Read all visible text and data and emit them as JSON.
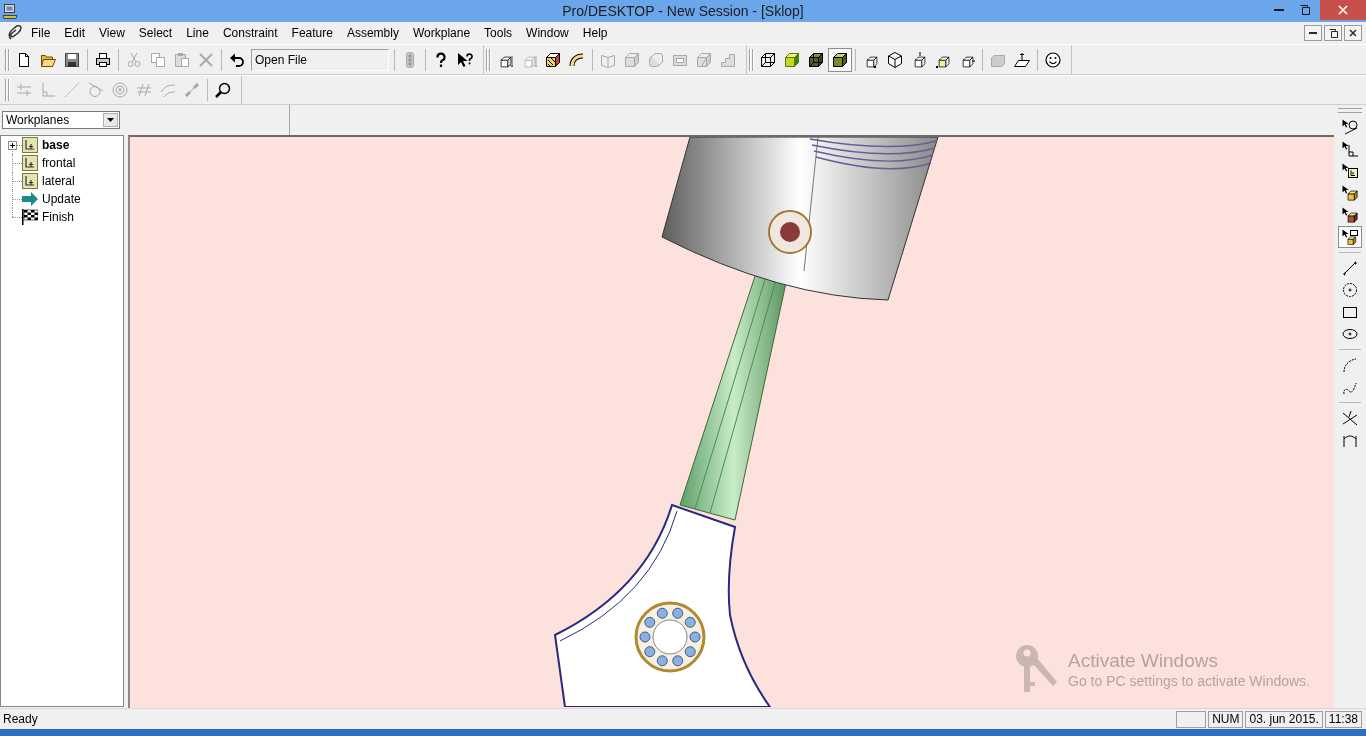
{
  "window": {
    "title": "Pro/DESKTOP - New Session - [Sklop]"
  },
  "menu_bar": {
    "items": [
      "File",
      "Edit",
      "View",
      "Select",
      "Line",
      "Constraint",
      "Feature",
      "Assembly",
      "Workplane",
      "Tools",
      "Window",
      "Help"
    ]
  },
  "toolbar_rows": [
    {
      "toolbars": [
        {
          "groups": [
            [
              {
                "kind": "new",
                "disabled": false
              },
              {
                "kind": "open",
                "disabled": false
              },
              {
                "kind": "save",
                "disabled": false
              }
            ],
            [
              {
                "kind": "print",
                "disabled": false
              }
            ],
            [
              {
                "kind": "cut",
                "disabled": true
              },
              {
                "kind": "copy",
                "disabled": true
              },
              {
                "kind": "paste",
                "disabled": true
              },
              {
                "kind": "delete",
                "disabled": true
              }
            ],
            [
              {
                "kind": "undo",
                "disabled": false
              },
              {
                "kind": "field",
                "value": "Open File"
              }
            ],
            [
              {
                "kind": "traffic_light",
                "disabled": true
              }
            ],
            [
              {
                "kind": "help",
                "disabled": false
              },
              {
                "kind": "context_help",
                "disabled": false
              }
            ]
          ]
        },
        {
          "groups": [
            [
              {
                "kind": "cube_arrow",
                "disabled": false
              },
              {
                "kind": "cube_arrow_down",
                "disabled": true
              },
              {
                "kind": "patterned_solid",
                "disabled": false
              },
              {
                "kind": "pipe",
                "disabled": false
              }
            ],
            [
              {
                "kind": "book",
                "disabled": true
              },
              {
                "kind": "cube",
                "disabled": true
              },
              {
                "kind": "rounded_box",
                "disabled": true
              },
              {
                "kind": "panel",
                "disabled": true
              },
              {
                "kind": "cut_cube",
                "disabled": true
              },
              {
                "kind": "steps",
                "disabled": true
              }
            ]
          ]
        },
        {
          "groups": [
            [
              {
                "kind": "wire_cube",
                "disabled": false,
                "selected": false
              },
              {
                "kind": "shaded_cube",
                "disabled": false,
                "selected": false
              },
              {
                "kind": "edged_cube",
                "disabled": false,
                "selected": false
              },
              {
                "kind": "solid_cube",
                "disabled": false,
                "selected": true
              }
            ],
            [
              {
                "kind": "view_front",
                "disabled": false
              },
              {
                "kind": "view_iso",
                "disabled": false
              },
              {
                "kind": "view_top",
                "disabled": false
              },
              {
                "kind": "view_corner",
                "disabled": false
              },
              {
                "kind": "view_side",
                "disabled": false
              }
            ],
            [
              {
                "kind": "shaded_panel",
                "disabled": true
              },
              {
                "kind": "plane",
                "disabled": false
              }
            ],
            [
              {
                "kind": "smiley",
                "disabled": false
              }
            ]
          ]
        }
      ]
    },
    {
      "toolbars": [
        {
          "groups": [
            [
              {
                "kind": "parallel",
                "disabled": true
              },
              {
                "kind": "perpendicular",
                "disabled": true
              },
              {
                "kind": "diagonal",
                "disabled": true
              },
              {
                "kind": "tangent",
                "disabled": true
              },
              {
                "kind": "concentric",
                "disabled": true
              },
              {
                "kind": "equal",
                "disabled": true
              },
              {
                "kind": "curve_pair",
                "disabled": true
              },
              {
                "kind": "chain",
                "disabled": true
              }
            ],
            [
              {
                "kind": "zoom",
                "disabled": false
              }
            ]
          ]
        }
      ]
    }
  ],
  "workplane_selector": {
    "value": "Workplanes"
  },
  "tree": [
    {
      "label": "base",
      "kind": "workplane",
      "active": true,
      "expanded": false
    },
    {
      "label": "frontal",
      "kind": "workplane",
      "active": false
    },
    {
      "label": "lateral",
      "kind": "workplane",
      "active": false
    },
    {
      "label": "Update",
      "kind": "update",
      "active": false
    },
    {
      "label": "Finish",
      "kind": "finish",
      "active": false
    }
  ],
  "side_toolbar": {
    "groups": [
      [
        {
          "kind": "pick_circle",
          "disabled": false,
          "selected": false
        },
        {
          "kind": "pick_angle",
          "disabled": false,
          "selected": false
        },
        {
          "kind": "pick_plane",
          "disabled": false,
          "selected": false
        },
        {
          "kind": "pick_cube",
          "disabled": false,
          "selected": false
        },
        {
          "kind": "pick_hatched",
          "disabled": false,
          "selected": false
        },
        {
          "kind": "pick_stack",
          "disabled": false,
          "selected": true
        }
      ],
      [
        {
          "kind": "line",
          "disabled": false
        },
        {
          "kind": "circle",
          "disabled": false
        },
        {
          "kind": "rect",
          "disabled": false
        },
        {
          "kind": "ellipse",
          "disabled": false
        }
      ],
      [
        {
          "kind": "arc",
          "disabled": false
        },
        {
          "kind": "spline",
          "disabled": false
        }
      ],
      [
        {
          "kind": "trim",
          "disabled": false
        },
        {
          "kind": "dimension",
          "disabled": false
        }
      ]
    ]
  },
  "activation_notice": {
    "title": "Activate Windows",
    "message": "Go to PC settings to activate Windows."
  },
  "status_bar": {
    "message": "Ready",
    "panes": [
      "NUM",
      "03. jun 2015.",
      "11:38"
    ]
  }
}
